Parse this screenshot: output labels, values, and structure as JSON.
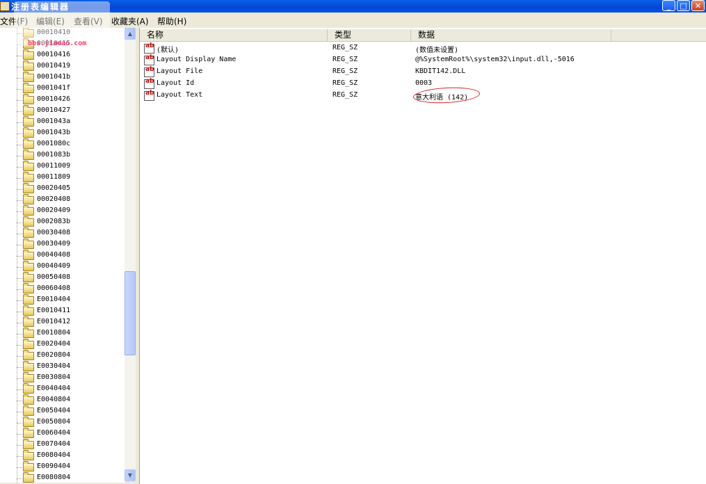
{
  "window": {
    "title": "注册表编辑器"
  },
  "title_buttons": {
    "minimize": "_",
    "maximize": "□",
    "close": "✕"
  },
  "menu": [
    {
      "label": "文件(F)"
    },
    {
      "label": "编辑(E)"
    },
    {
      "label": "查看(V)"
    },
    {
      "label": "收藏夹(A)"
    },
    {
      "label": "帮助(H)"
    }
  ],
  "watermark": {
    "text": "bbs.jiaoao.com"
  },
  "tree": {
    "items": [
      "00010410",
      "00010415",
      "00010416",
      "00010419",
      "0001041b",
      "0001041f",
      "00010426",
      "00010427",
      "0001043a",
      "0001043b",
      "0001080c",
      "0001083b",
      "00011009",
      "00011809",
      "00020405",
      "00020408",
      "00020409",
      "0002083b",
      "00030408",
      "00030409",
      "00040408",
      "00040409",
      "00050408",
      "00060408",
      "E0010404",
      "E0010411",
      "E0010412",
      "E0010804",
      "E0020404",
      "E0020804",
      "E0030404",
      "E0030804",
      "E0040404",
      "E0040804",
      "E0050404",
      "E0050804",
      "E0060404",
      "E0070404",
      "E0080404",
      "E0090404",
      "E0080804"
    ]
  },
  "list": {
    "columns": [
      "名称",
      "类型",
      "数据"
    ],
    "rows": [
      {
        "name": "(默认)",
        "type": "REG_SZ",
        "data": "(数值未设置)"
      },
      {
        "name": "Layout Display Name",
        "type": "REG_SZ",
        "data": "@%SystemRoot%\\system32\\input.dll,-5016"
      },
      {
        "name": "Layout File",
        "type": "REG_SZ",
        "data": "KBDIT142.DLL"
      },
      {
        "name": "Layout Id",
        "type": "REG_SZ",
        "data": "0003"
      },
      {
        "name": "Layout Text",
        "type": "REG_SZ",
        "data": "意大利语 (142)"
      }
    ]
  },
  "colors": {
    "titlebar": "#0346d8",
    "annotation": "#d82020",
    "menubar": "#ece9d8"
  }
}
